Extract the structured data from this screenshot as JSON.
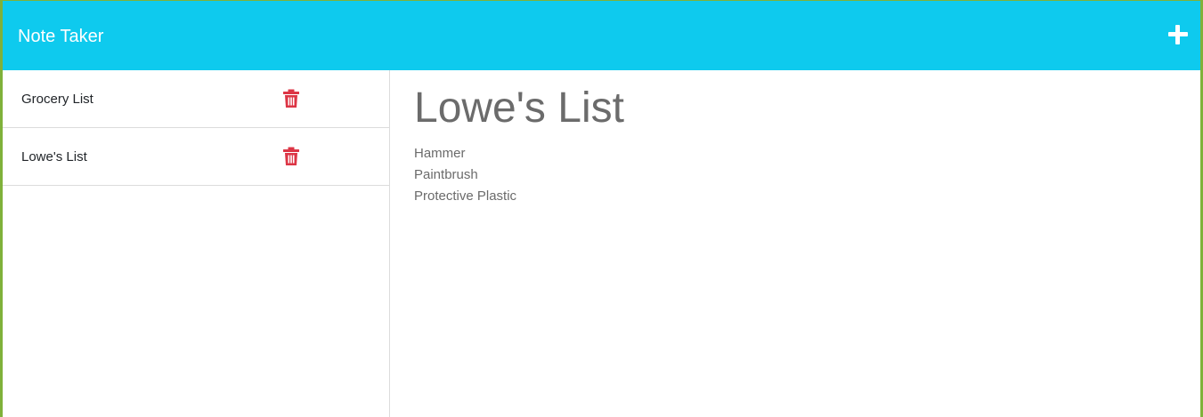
{
  "app": {
    "title": "Note Taker",
    "new_note_icon": "plus-icon"
  },
  "colors": {
    "navbar": "#0ecaee",
    "delete_icon": "#dc3545",
    "text_muted": "#6b6b6b"
  },
  "sidebar": {
    "notes": [
      {
        "title": "Grocery List",
        "delete_icon": "trash-icon"
      },
      {
        "title": "Lowe's List",
        "delete_icon": "trash-icon"
      }
    ]
  },
  "active_note": {
    "title": "Lowe's List",
    "lines": [
      "Hammer",
      "Paintbrush",
      "Protective Plastic"
    ]
  }
}
